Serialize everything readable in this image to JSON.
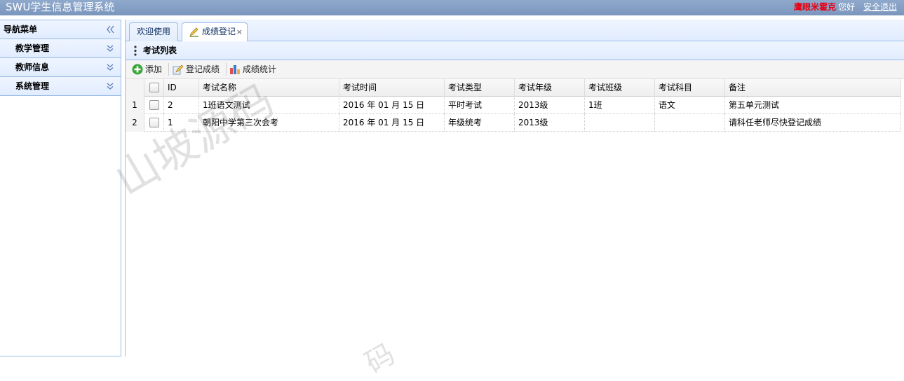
{
  "header": {
    "app_title": "SWU学生信息管理系统",
    "user_name": "鹰眼米霍克",
    "greeting": "您好",
    "logout_label": "安全退出"
  },
  "sidebar": {
    "title": "导航菜单",
    "items": [
      {
        "label": "教学管理"
      },
      {
        "label": "教师信息"
      },
      {
        "label": "系统管理"
      }
    ]
  },
  "tabs": [
    {
      "label": "欢迎使用",
      "active": false
    },
    {
      "label": "成绩登记",
      "active": true,
      "close": "×"
    }
  ],
  "panel": {
    "title": "考试列表"
  },
  "toolbar": {
    "add_label": "添加",
    "register_label": "登记成绩",
    "stats_label": "成绩统计"
  },
  "grid": {
    "columns": [
      "ID",
      "考试名称",
      "考试时间",
      "考试类型",
      "考试年级",
      "考试班级",
      "考试科目",
      "备注"
    ],
    "rows": [
      {
        "num": "1",
        "id": "2",
        "name": "1班语文测试",
        "time": "2016 年 01 月 15 日",
        "type": "平时考试",
        "grade": "2013级",
        "class": "1班",
        "subject": "语文",
        "remark": "第五单元测试"
      },
      {
        "num": "2",
        "id": "1",
        "name": "朝阳中学第三次会考",
        "time": "2016 年 01 月 15 日",
        "type": "年级统考",
        "grade": "2013级",
        "class": "",
        "subject": "",
        "remark": "请科任老师尽快登记成绩"
      }
    ]
  },
  "watermark": {
    "text": "山坡源码",
    "text2": "码"
  },
  "colors": {
    "header_bg": "#7b96bd",
    "border": "#99bbe8",
    "user_name": "#e60012"
  }
}
